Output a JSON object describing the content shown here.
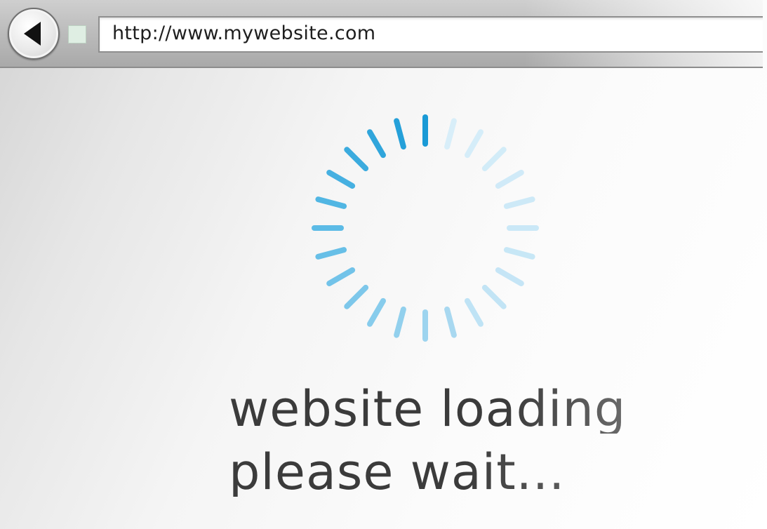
{
  "browser": {
    "back_icon": "back-arrow-icon",
    "page_icon": "page-icon",
    "address_url": "http://www.mywebsite.com"
  },
  "loading": {
    "spinner_icon": "loading-spinner-icon",
    "spinner_segment_count": 24,
    "colors": {
      "accent_dark": "#1a9ad6",
      "accent_mid": "#5cbbe6",
      "accent_light": "#d8eef9"
    },
    "message_line_1": "website loading",
    "message_line_2": "please wait..."
  }
}
